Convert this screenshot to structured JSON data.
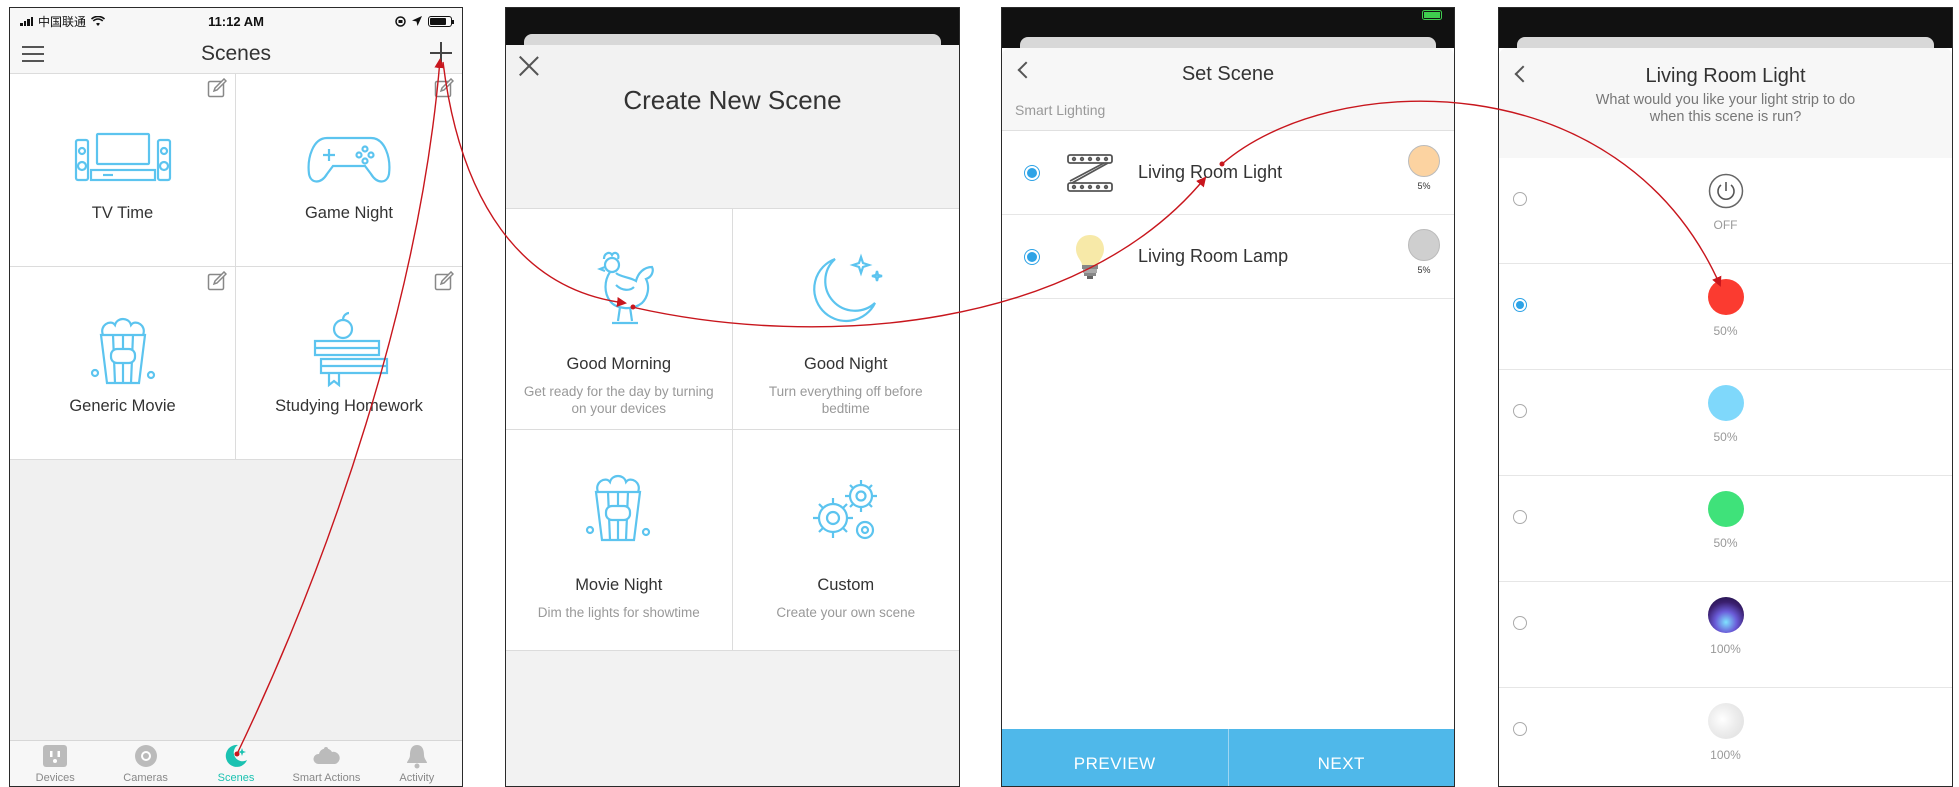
{
  "panel1": {
    "status": {
      "carrier": "中国联通",
      "time": "11:12 AM"
    },
    "title": "Scenes",
    "scenes": [
      {
        "label": "TV Time",
        "icon": "tv-icon"
      },
      {
        "label": "Game Night",
        "icon": "gamepad-icon"
      },
      {
        "label": "Generic Movie",
        "icon": "popcorn-icon"
      },
      {
        "label": "Studying Homework",
        "icon": "books-apple-icon"
      }
    ],
    "tabs": [
      {
        "label": "Devices",
        "icon": "outlet-icon"
      },
      {
        "label": "Cameras",
        "icon": "camera-icon"
      },
      {
        "label": "Scenes",
        "icon": "moon-icon",
        "active": true
      },
      {
        "label": "Smart Actions",
        "icon": "cloud-icon"
      },
      {
        "label": "Activity",
        "icon": "bell-icon"
      }
    ]
  },
  "panel2": {
    "title": "Create New Scene",
    "templates": [
      {
        "name": "Good Morning",
        "desc": "Get ready for the day by turning on your devices",
        "icon": "rooster-icon"
      },
      {
        "name": "Good Night",
        "desc": "Turn everything off before bedtime",
        "icon": "moon-stars-icon"
      },
      {
        "name": "Movie Night",
        "desc": "Dim the lights for showtime",
        "icon": "popcorn-icon"
      },
      {
        "name": "Custom",
        "desc": "Create your own scene",
        "icon": "gears-icon"
      }
    ]
  },
  "panel3": {
    "title": "Set Scene",
    "section": "Smart Lighting",
    "devices": [
      {
        "name": "Living Room Light",
        "icon": "light-strip-icon",
        "color": "#fcd3a1",
        "percent": "5%"
      },
      {
        "name": "Living Room Lamp",
        "icon": "bulb-icon",
        "color": "#cfcfcf",
        "percent": "5%"
      }
    ],
    "buttons": {
      "preview": "PREVIEW",
      "next": "NEXT"
    }
  },
  "panel4": {
    "title": "Living Room Light",
    "subtitle": "What would you like your light strip to do when this scene is run?",
    "options": [
      {
        "value": "OFF",
        "icon": "power-icon",
        "selected": false
      },
      {
        "value": "50%",
        "color": "#fb3b30",
        "selected": true
      },
      {
        "value": "50%",
        "color": "#7fd8fb",
        "selected": false
      },
      {
        "value": "50%",
        "color": "#3fe27a",
        "selected": false
      },
      {
        "value": "100%",
        "color": "aurora",
        "selected": false
      },
      {
        "value": "100%",
        "color": "#e8e8e8",
        "selected": false
      }
    ]
  },
  "colors": {
    "accent": "#1bc2b1",
    "blue": "#2ea3e6",
    "iconBlue": "#5cc4ef",
    "buttonBar": "#4fb8ea",
    "arrow": "#c8161d"
  }
}
